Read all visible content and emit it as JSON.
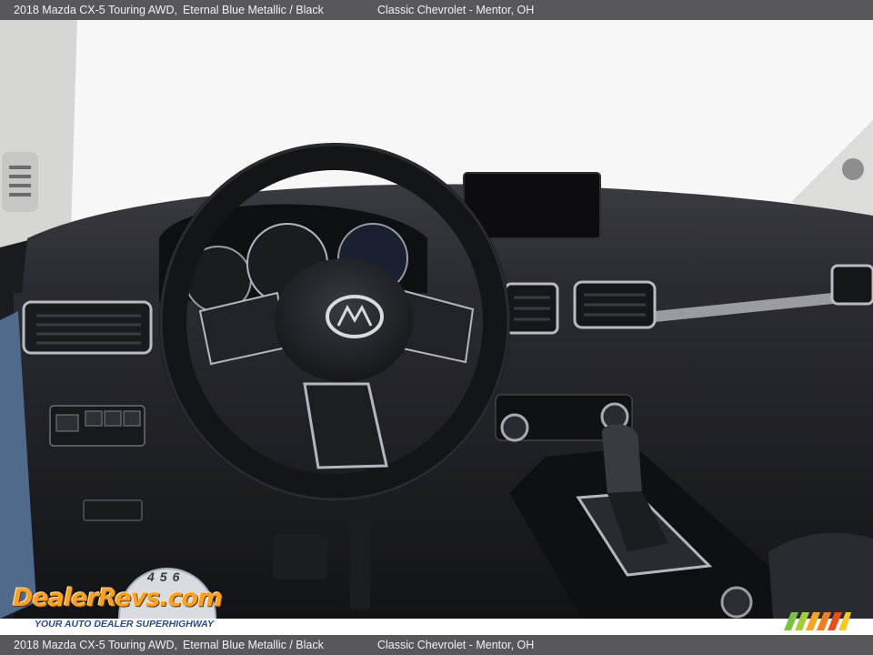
{
  "header": {
    "vehicle": "2018 Mazda CX-5 Touring AWD,",
    "color": "Eternal Blue Metallic / Black",
    "dealer": "Classic Chevrolet - Mentor, OH"
  },
  "footer": {
    "vehicle": "2018 Mazda CX-5 Touring AWD,",
    "color": "Eternal Blue Metallic / Black",
    "dealer": "Classic Chevrolet - Mentor, OH"
  },
  "watermark": {
    "brand": "DealerRevs.com",
    "dial_digits": "456",
    "tagline": "YOUR AUTO DEALER SUPERHIGHWAY"
  },
  "colors": {
    "bar_bg": "#58585a",
    "bar_text": "#f2f2f2",
    "watermark_orange": "#f5a12a",
    "tagline_blue": "#2b4a8a"
  }
}
